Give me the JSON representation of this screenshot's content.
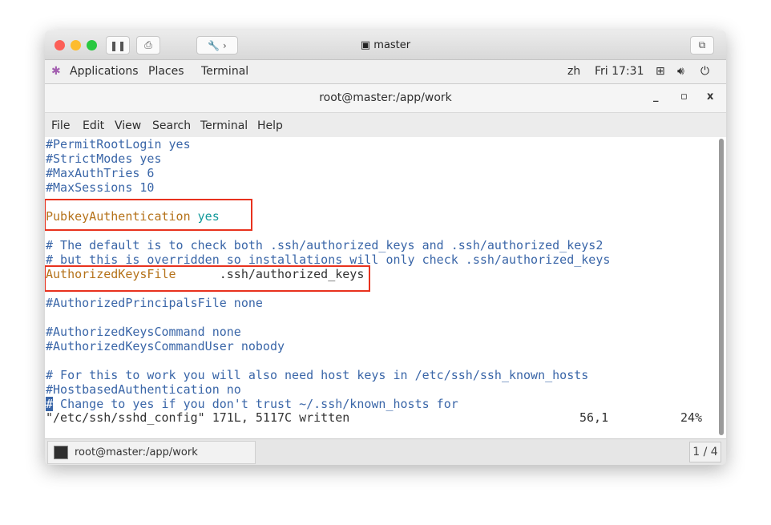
{
  "vm": {
    "title": "master"
  },
  "topbar": {
    "applications": "Applications",
    "places": "Places",
    "terminal": "Terminal",
    "lang": "zh",
    "clock": "Fri 17:31"
  },
  "window": {
    "title": "root@master:/app/work",
    "minimize": "_",
    "maximize": "▫",
    "close": "x"
  },
  "menu": [
    "File",
    "Edit",
    "View",
    "Search",
    "Terminal",
    "Help"
  ],
  "lines": [
    {
      "row": 0,
      "parts": [
        {
          "t": "#PermitRootLogin yes",
          "c": "c"
        }
      ]
    },
    {
      "row": 1,
      "parts": [
        {
          "t": "#StrictModes yes",
          "c": "c"
        }
      ]
    },
    {
      "row": 2,
      "parts": [
        {
          "t": "#MaxAuthTries 6",
          "c": "c"
        }
      ]
    },
    {
      "row": 3,
      "parts": [
        {
          "t": "#MaxSessions 10",
          "c": "c"
        }
      ]
    },
    {
      "row": 5,
      "parts": [
        {
          "t": "PubkeyAuthentication",
          "c": "o"
        },
        {
          "t": " yes",
          "c": "y"
        }
      ]
    },
    {
      "row": 7,
      "parts": [
        {
          "t": "# The default is to check both .ssh/authorized_keys and .ssh/authorized_keys2",
          "c": "c"
        }
      ]
    },
    {
      "row": 8,
      "parts": [
        {
          "t": "# but this is overridden so installations will only check .ssh/authorized_keys",
          "c": "c"
        }
      ]
    },
    {
      "row": 9,
      "parts": [
        {
          "t": "AuthorizedKeysFile",
          "c": "o"
        },
        {
          "t": "      .ssh/authorized_keys",
          "c": "k"
        }
      ]
    },
    {
      "row": 11,
      "parts": [
        {
          "t": "#AuthorizedPrincipalsFile none",
          "c": "c"
        }
      ]
    },
    {
      "row": 13,
      "parts": [
        {
          "t": "#AuthorizedKeysCommand none",
          "c": "c"
        }
      ]
    },
    {
      "row": 14,
      "parts": [
        {
          "t": "#AuthorizedKeysCommandUser nobody",
          "c": "c"
        }
      ]
    },
    {
      "row": 16,
      "parts": [
        {
          "t": "# For this to work you will also need host keys in /etc/ssh/ssh_known_hosts",
          "c": "c"
        }
      ]
    },
    {
      "row": 17,
      "parts": [
        {
          "t": "#HostbasedAuthentication no",
          "c": "c"
        }
      ]
    },
    {
      "row": 18,
      "parts": [
        {
          "t": "#",
          "c": "cur"
        },
        {
          "t": " Change to yes if you don't trust ~/.ssh/known_hosts for",
          "c": "c"
        }
      ]
    }
  ],
  "status": {
    "message": "\"/etc/ssh/sshd_config\" 171L, 5117C written",
    "position": "56,1",
    "percent": "24%"
  },
  "taskbar": {
    "item": "root@master:/app/work",
    "pager": "1 / 4"
  },
  "colors": {
    "comment": "#3a66a8",
    "keyword": "#b5721a",
    "value": "#12999a",
    "highlight": "#e8321e"
  }
}
